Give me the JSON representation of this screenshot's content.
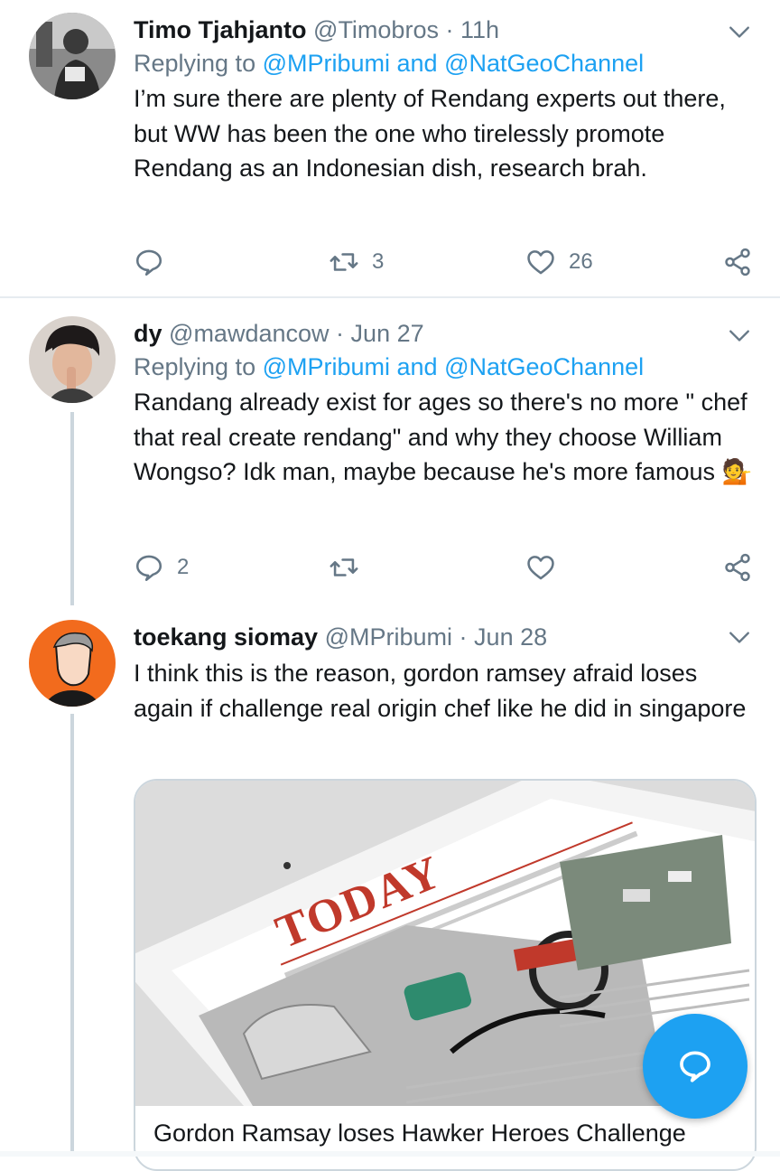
{
  "tweets": [
    {
      "name": "Timo Tjahjanto",
      "handle": "@Timobros",
      "time": "11h",
      "replying_prefix": "Replying to ",
      "replying_users": [
        "@MPribumi",
        "@NatGeoChannel"
      ],
      "replying_and": " and ",
      "text": "I’m sure there are plenty of Rendang experts out there, but WW has been the one who tirelessly promote Rendang as an Indonesian dish, research brah.",
      "retweets": "3",
      "likes": "26"
    },
    {
      "name": "dy",
      "handle": "@mawdancow",
      "time": "Jun 27",
      "replying_prefix": "Replying to ",
      "replying_users": [
        "@MPribumi",
        "@NatGeoChannel"
      ],
      "replying_and": " and ",
      "text": "Randang already exist for ages so there's no more \" chef that real create rendang\" and why they choose William Wongso? Idk man, maybe because he's more famous",
      "emoji": "💁",
      "replies": "2"
    },
    {
      "name": "toekang siomay",
      "handle": "@MPribumi",
      "time": "Jun 28",
      "text": "I think this is the reason, gordon ramsey afraid loses again if challenge real origin chef like he did in singapore",
      "card_title": "Gordon Ramsay loses Hawker Heroes Challenge",
      "card_image_text": "TODAY"
    }
  ],
  "separator": "·",
  "colors": {
    "accent": "#1da1f2",
    "secondary_text": "#657786",
    "divider": "#e6ecf0"
  },
  "icons": [
    "reply-icon",
    "retweet-icon",
    "like-icon",
    "share-icon",
    "chevron-down-icon",
    "compose-icon"
  ]
}
